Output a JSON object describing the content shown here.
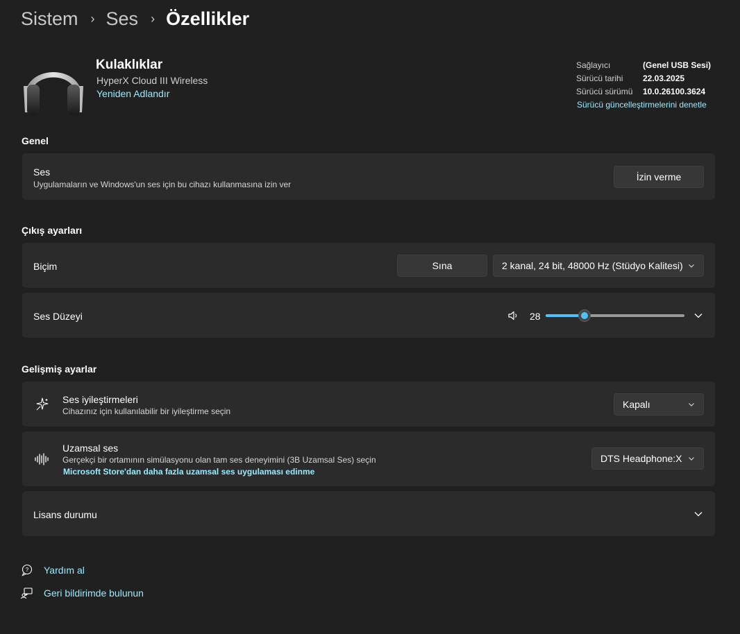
{
  "breadcrumb": {
    "items": [
      "Sistem",
      "Ses"
    ],
    "current": "Özellikler"
  },
  "device": {
    "name": "Kulaklıklar",
    "model": "HyperX Cloud III Wireless",
    "rename_link": "Yeniden Adlandır",
    "icon": "headphones-icon"
  },
  "driver_info": {
    "rows": [
      {
        "label": "Sağlayıcı",
        "value": "(Genel USB Sesi)"
      },
      {
        "label": "Sürücü tarihi",
        "value": "22.03.2025"
      },
      {
        "label": "Sürücü sürümü",
        "value": "10.0.26100.3624"
      }
    ],
    "update_link": "Sürücü güncelleştirmelerini denetle"
  },
  "general": {
    "header": "Genel",
    "audio": {
      "title": "Ses",
      "description": "Uygulamaların ve Windows'un ses için bu cihazı kullanmasına izin ver",
      "button": "İzin verme"
    }
  },
  "output": {
    "header": "Çıkış ayarları",
    "format": {
      "title": "Biçim",
      "test_button": "Sına",
      "selected": "2 kanal, 24 bit, 48000 Hz (Stüdyo Kalitesi)"
    },
    "volume": {
      "title": "Ses Düzeyi",
      "value": "28",
      "fraction": 0.28,
      "icon": "speaker-icon"
    }
  },
  "advanced": {
    "header": "Gelişmiş ayarlar",
    "enhancements": {
      "title": "Ses iyileştirmeleri",
      "description": "Cihazınız için kullanılabilir bir iyileştirme seçin",
      "selected": "Kapalı",
      "icon": "sparkle-icon"
    },
    "spatial": {
      "title": "Uzamsal ses",
      "description": "Gerçekçi bir ortamının simülasyonu olan tam ses deneyimini (3B Uzamsal Ses) seçin",
      "link": "Microsoft Store'dan daha fazla uzamsal ses uygulaması edinme",
      "selected": "DTS Headphone:X",
      "icon": "waveform-icon"
    },
    "license": {
      "title": "Lisans durumu"
    }
  },
  "footer": {
    "help": "Yardım al",
    "feedback": "Geri bildirimde bulunun"
  },
  "colors": {
    "background": "#202020",
    "card": "#2b2b2b",
    "accent": "#4cc2ff",
    "link": "#99ebff"
  }
}
